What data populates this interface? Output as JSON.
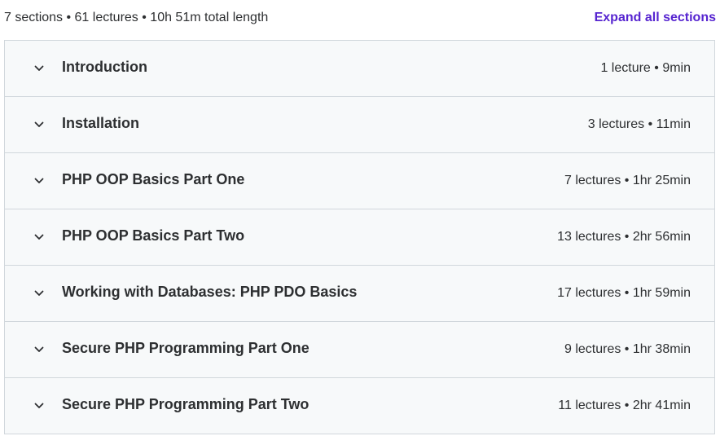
{
  "header": {
    "summary": "7 sections • 61 lectures • 10h 51m total length",
    "expand_label": "Expand all sections"
  },
  "colors": {
    "accent": "#5624d0",
    "row_bg": "#f7f9fa",
    "border": "#d1d7dc",
    "text": "#2d2f31"
  },
  "sections": [
    {
      "title": "Introduction",
      "meta": "1 lecture • 9min",
      "icon": "chevron-down-icon"
    },
    {
      "title": "Installation",
      "meta": "3 lectures • 11min",
      "icon": "chevron-down-icon"
    },
    {
      "title": "PHP OOP Basics Part One",
      "meta": "7 lectures • 1hr 25min",
      "icon": "chevron-down-icon"
    },
    {
      "title": "PHP OOP Basics Part Two",
      "meta": "13 lectures • 2hr 56min",
      "icon": "chevron-down-icon"
    },
    {
      "title": "Working with Databases: PHP PDO Basics",
      "meta": "17 lectures • 1hr 59min",
      "icon": "chevron-down-icon"
    },
    {
      "title": "Secure PHP Programming Part One",
      "meta": "9 lectures • 1hr 38min",
      "icon": "chevron-down-icon"
    },
    {
      "title": "Secure PHP Programming Part Two",
      "meta": "11 lectures • 2hr 41min",
      "icon": "chevron-down-icon"
    }
  ]
}
